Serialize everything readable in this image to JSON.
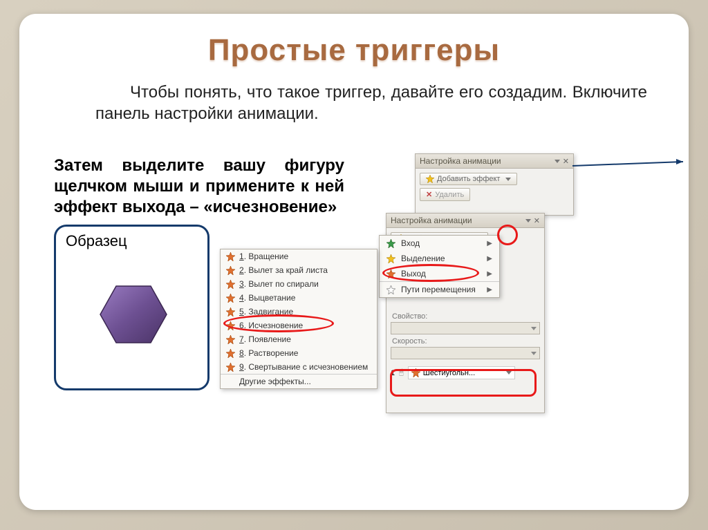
{
  "title": "Простые триггеры",
  "para1": "Чтобы понять, что такое триггер, давайте его создадим.  Включите панель настройки анимации.",
  "para2": "Затем выделите  вашу фигуру щелчком мыши и примените к ней эффект выхода – «исчезновение»",
  "sample_label": "Образец",
  "panel": {
    "header": "Настройка анимации",
    "add_effect": "Добавить эффект",
    "delete": "Удалить",
    "property": "Свойство:",
    "speed": "Скорость:",
    "item_idx": "1",
    "item_name": "Шестиугольн..."
  },
  "submenu": {
    "items": [
      "Вход",
      "Выделение",
      "Выход",
      "Пути перемещения"
    ]
  },
  "effects": {
    "items": [
      "Вращение",
      "Вылет за край листа",
      "Вылет по спирали",
      "Выцветание",
      "Задвигание",
      "Исчезновение",
      "Появление",
      "Растворение",
      "Свертывание с исчезновением"
    ],
    "more": "Другие эффекты..."
  }
}
